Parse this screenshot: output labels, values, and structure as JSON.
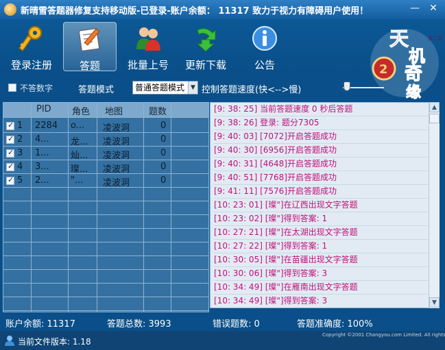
{
  "window": {
    "title": "新晴雪答题器修复支持移动版-已登录-账户余额： 11317 致力于视力有障碍用户使用！",
    "minimize": "—",
    "close": "✕"
  },
  "toolbar": {
    "items": [
      {
        "label": "登录注册",
        "icon": "key-icon"
      },
      {
        "label": "答题",
        "icon": "pencil-paper-icon"
      },
      {
        "label": "批量上号",
        "icon": "users-icon"
      },
      {
        "label": "更新下载",
        "icon": "download-arrow-icon"
      },
      {
        "label": "公告",
        "icon": "info-icon"
      }
    ],
    "active_index": 1
  },
  "logo": {
    "text": "天机奇缘",
    "sub": "第二季"
  },
  "options": {
    "no_answer_label": "不答数字",
    "mode_label": "答题模式",
    "mode_value": "普通答题模式",
    "speed_label": "控制答题速度(快<-->慢)",
    "speed_level": 0.05
  },
  "table": {
    "headers": [
      "PID",
      "角色",
      "地图",
      "题数"
    ],
    "rows": [
      {
        "no": "1",
        "checked": true,
        "pid": "2284",
        "role": "o...",
        "map": "凌波洞",
        "count": "0"
      },
      {
        "no": "2",
        "checked": true,
        "pid": "4...",
        "role": "龙...",
        "map": "凌波洞",
        "count": "0"
      },
      {
        "no": "3",
        "checked": true,
        "pid": "1...",
        "role": "灿...",
        "map": "凌波洞",
        "count": "0"
      },
      {
        "no": "4",
        "checked": true,
        "pid": "3...",
        "role": "璨...",
        "map": "凌波洞",
        "count": "0"
      },
      {
        "no": "5",
        "checked": true,
        "pid": "2...",
        "role": "\"...",
        "map": "凌波洞",
        "count": "0"
      }
    ]
  },
  "log": [
    "[9: 38: 25]    当前答题速度    0   秒后答题",
    "[9: 38: 26]    登录: 题分7305",
    "[9: 40: 03]    [7072]开启答题成功",
    "[9: 40: 30]    [6956]开启答题成功",
    "[9: 40: 31]    [4648]开启答题成功",
    "[9: 40: 51]    [7768]开启答题成功",
    "[9: 41: 11]    [7576]开启答题成功",
    "[10: 23: 01]     [璨\"]在辽西出现文字答题",
    "[10: 23: 02]     [璨\"]得到答案: 1",
    "[10: 27: 21]     [璨\"]在太湖出现文字答题",
    "[10: 27: 22]     [璨\"]得到答案: 1",
    "[10: 30: 05]     [璨\"]在苗疆出现文字答题",
    "[10: 30: 06]     [璨\"]得到答案: 3",
    "[10: 34: 49]     [璨\"]在雁南出现文字答题",
    "[10: 34: 49]     [璨\"]得到答案: 3"
  ],
  "stats": {
    "balance": "账户余额: 11317",
    "total": "答题总数:  3993",
    "errors": "错误题数: 0",
    "accuracy": "答题准确度:   100%"
  },
  "footer": {
    "version": "当前文件版本: 1.18",
    "copyright": "Copyright ©2001 Changyou.com Limited. All rights reserved."
  },
  "colors": {
    "log_text": "#c0117a",
    "accent": "#0a4f89"
  }
}
